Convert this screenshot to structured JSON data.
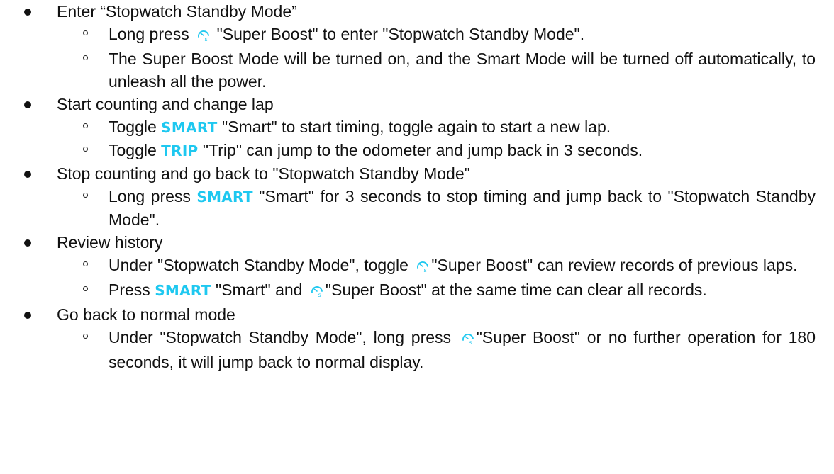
{
  "colors": {
    "accent": "#1ec8f0",
    "text": "#111111"
  },
  "icons": {
    "super_boost": "speedometer-s-icon"
  },
  "sections": [
    {
      "title": "Enter “Stopwatch Standby Mode”",
      "items": [
        {
          "parts": [
            {
              "type": "text",
              "value": "Long press "
            },
            {
              "type": "icon",
              "value": "super-boost-icon"
            },
            {
              "type": "text",
              "value": " \"Super Boost\" to enter \"Stopwatch Standby Mode\"."
            }
          ]
        },
        {
          "parts": [
            {
              "type": "text",
              "value": "The Super Boost Mode will be turned on, and the Smart Mode will be turned off automatically, to unleash all the power."
            }
          ]
        }
      ]
    },
    {
      "title": "Start counting and change lap",
      "items": [
        {
          "parts": [
            {
              "type": "text",
              "value": "Toggle "
            },
            {
              "type": "chip",
              "value": "SMART"
            },
            {
              "type": "text",
              "value": " \"Smart\" to start timing, toggle again to start a new lap."
            }
          ]
        },
        {
          "parts": [
            {
              "type": "text",
              "value": "Toggle "
            },
            {
              "type": "chip",
              "value": "TRIP"
            },
            {
              "type": "text",
              "value": "  \"Trip\" can jump to the odometer and jump back in 3 seconds."
            }
          ]
        }
      ]
    },
    {
      "title": "Stop counting and go back to \"Stopwatch Standby Mode\"",
      "items": [
        {
          "parts": [
            {
              "type": "text",
              "value": "Long press "
            },
            {
              "type": "chip",
              "value": "SMART"
            },
            {
              "type": "text",
              "value": " \"Smart\" for 3 seconds to stop timing and jump back to \"Stopwatch Standby Mode\"."
            }
          ]
        }
      ]
    },
    {
      "title": "Review history",
      "items": [
        {
          "parts": [
            {
              "type": "text",
              "value": "Under \"Stopwatch Standby Mode\", toggle "
            },
            {
              "type": "icon",
              "value": "super-boost-icon"
            },
            {
              "type": "text",
              "value": "\"Super Boost\" can review records of previous laps."
            }
          ]
        },
        {
          "parts": [
            {
              "type": "text",
              "value": "Press "
            },
            {
              "type": "chip",
              "value": "SMART"
            },
            {
              "type": "text",
              "value": " \"Smart\" and "
            },
            {
              "type": "icon",
              "value": "super-boost-icon"
            },
            {
              "type": "text",
              "value": "\"Super Boost\" at the same time can clear all records."
            }
          ]
        }
      ]
    },
    {
      "title": "Go back to normal mode",
      "items": [
        {
          "parts": [
            {
              "type": "text",
              "value": "Under \"Stopwatch Standby Mode\", long press "
            },
            {
              "type": "icon",
              "value": "super-boost-icon"
            },
            {
              "type": "text",
              "value": "\"Super Boost\" or no further operation for 180 seconds, it will jump back to normal display."
            }
          ]
        }
      ]
    }
  ]
}
